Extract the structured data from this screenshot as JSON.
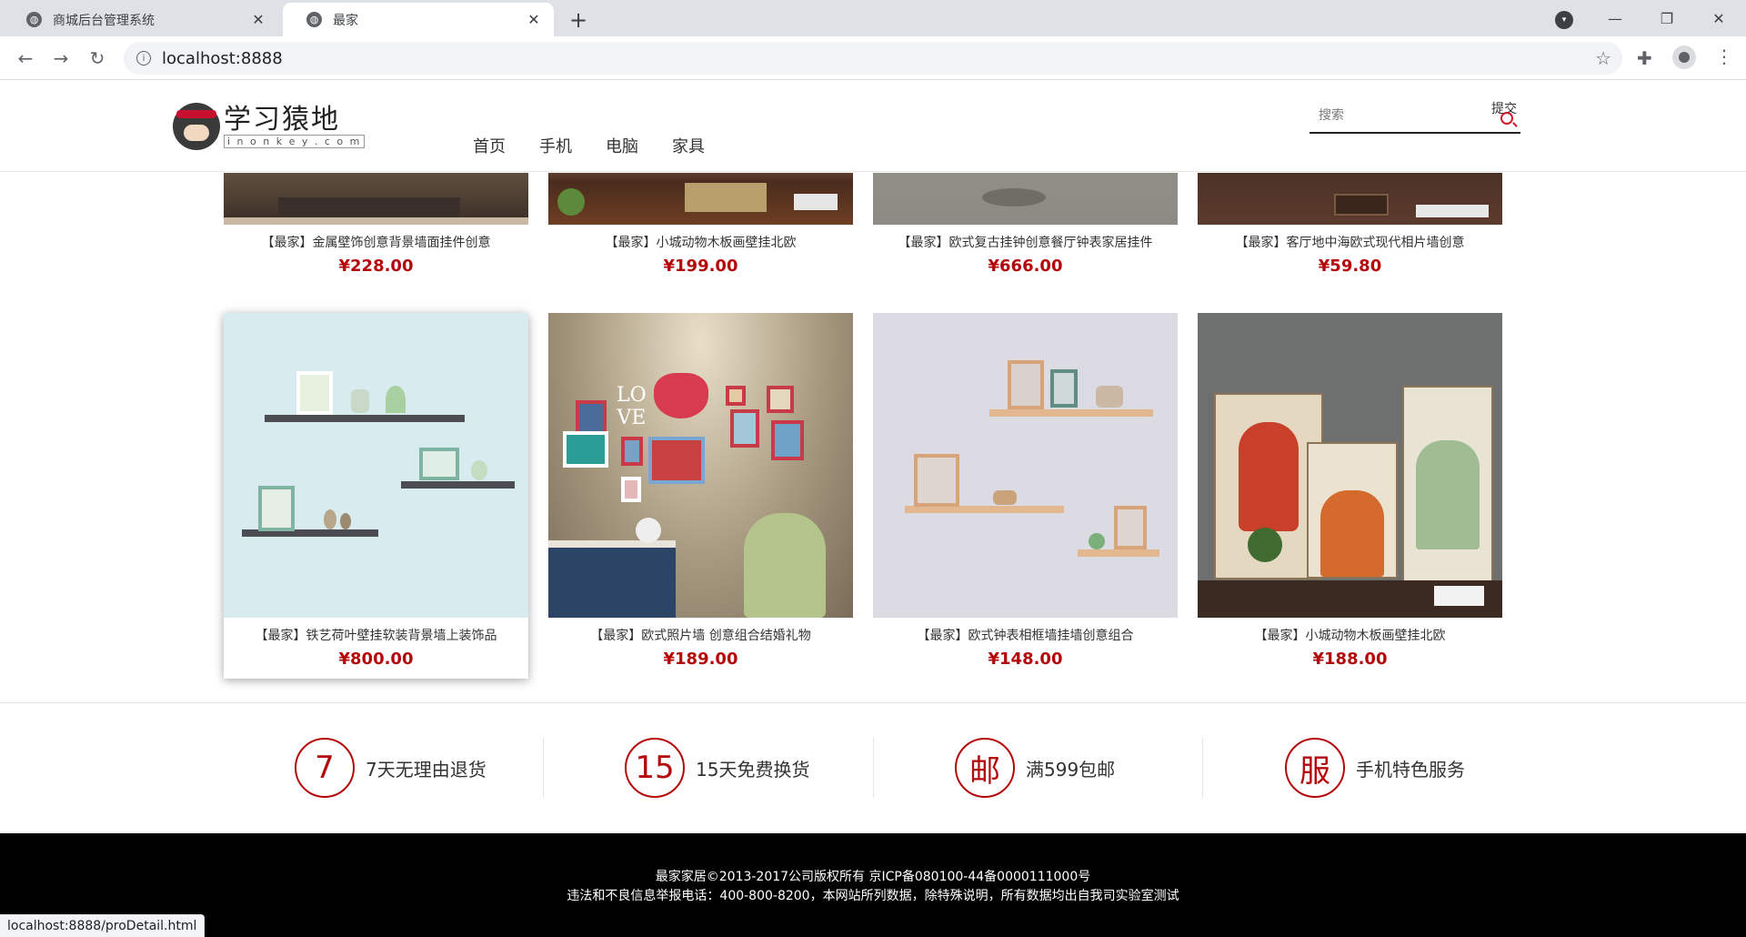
{
  "browser": {
    "tabs": [
      {
        "title": "商城后台管理系统",
        "active": false
      },
      {
        "title": "最家",
        "active": true
      }
    ],
    "url": "localhost:8888",
    "status_url": "localhost:8888/proDetail.html"
  },
  "header": {
    "logo_main": "学习猿地",
    "logo_sub": "i n o n k e y . c o m",
    "nav": [
      "首页",
      "手机",
      "电脑",
      "家具"
    ],
    "search_placeholder": "搜索",
    "search_submit": "提交"
  },
  "products_row1": [
    {
      "name": "【最家】金属壁饰创意背景墙面挂件创意",
      "price": "¥228.00"
    },
    {
      "name": "【最家】小城动物木板画壁挂北欧",
      "price": "¥199.00"
    },
    {
      "name": "【最家】欧式复古挂钟创意餐厅钟表家居挂件",
      "price": "¥666.00"
    },
    {
      "name": "【最家】客厅地中海欧式现代相片墙创意",
      "price": "¥59.80"
    }
  ],
  "products_row2": [
    {
      "name": "【最家】铁艺荷叶壁挂软装背景墙上装饰品",
      "price": "¥800.00"
    },
    {
      "name": "【最家】欧式照片墙 创意组合结婚礼物",
      "price": "¥189.00"
    },
    {
      "name": "【最家】欧式钟表相框墙挂墙创意组合",
      "price": "¥148.00"
    },
    {
      "name": "【最家】小城动物木板画壁挂北欧",
      "price": "¥188.00"
    }
  ],
  "services": [
    {
      "icon_text": "7",
      "label": "7天无理由退货"
    },
    {
      "icon_text": "15",
      "label": "15天免费换货"
    },
    {
      "icon_text": "邮",
      "label": "满599包邮"
    },
    {
      "icon_text": "服",
      "label": "手机特色服务"
    }
  ],
  "footer": {
    "line1": "最家家居©2013-2017公司版权所有 京ICP备080100-44备0000111000号",
    "line2": "违法和不良信息举报电话：400-800-8200，本网站所列数据，除特殊说明，所有数据均出自我司实验室测试"
  },
  "colors": {
    "accent": "#b4070b",
    "footer_bg": "#000000"
  }
}
